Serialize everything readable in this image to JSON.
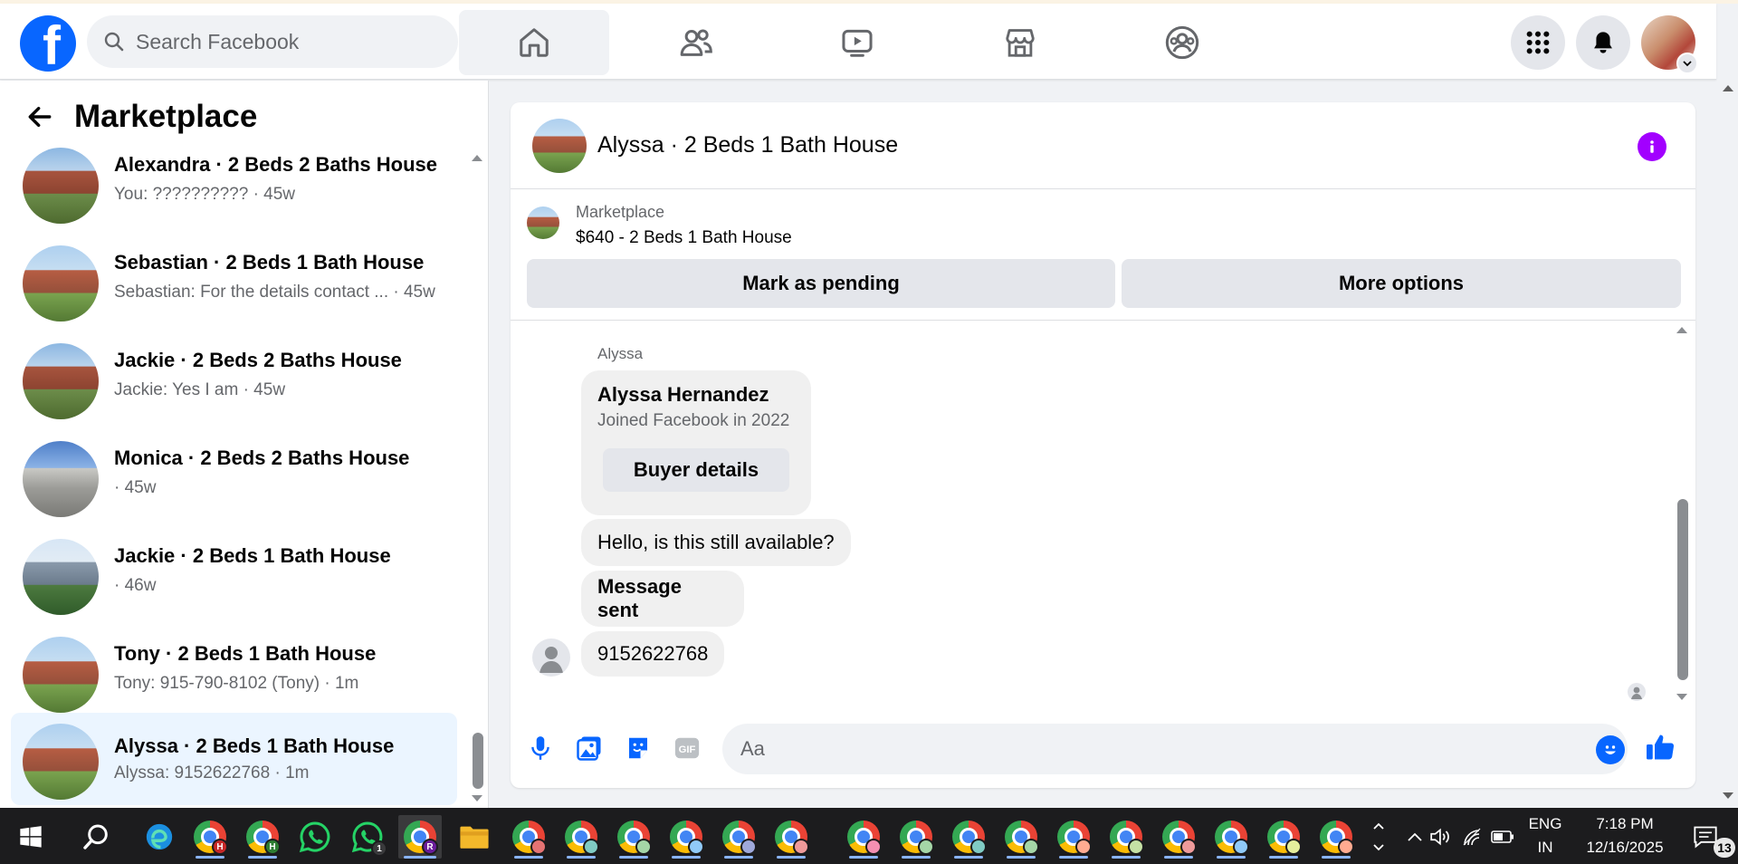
{
  "topbar": {
    "logo_text": "f",
    "search_placeholder": "Search Facebook",
    "colors": {
      "brand": "#0866ff"
    }
  },
  "sidebar": {
    "title": "Marketplace",
    "conversations": [
      {
        "title": "Alexandra · 2 Beds 2 Baths House",
        "subtitle": "You: ?????????? · 45w"
      },
      {
        "title": "Sebastian · 2 Beds 1 Bath House",
        "subtitle": "Sebastian: For the details contact ... · 45w"
      },
      {
        "title": "Jackie · 2 Beds 2 Baths House",
        "subtitle": "Jackie: Yes I am · 45w"
      },
      {
        "title": "Monica · 2 Beds 2 Baths House",
        "subtitle": "· 45w"
      },
      {
        "title": "Jackie · 2 Beds 1 Bath House",
        "subtitle": "· 46w"
      },
      {
        "title": "Tony · 2 Beds 1 Bath House",
        "subtitle": "Tony: 915-790-8102 (Tony) · 1m"
      },
      {
        "title": "Alyssa · 2 Beds 1 Bath House",
        "subtitle": "Alyssa: 9152622768 · 1m"
      }
    ]
  },
  "chat": {
    "title": "Alyssa · 2 Beds 1 Bath House",
    "listing": {
      "source": "Marketplace",
      "price_title": "$640 - 2 Beds 1 Bath House",
      "mark_pending": "Mark as pending",
      "more_options": "More options"
    },
    "sender_label": "Alyssa",
    "profile_card": {
      "name": "Alyssa Hernandez",
      "joined": "Joined Facebook in 2022",
      "button": "Buyer details"
    },
    "messages": [
      "Hello, is this still available?",
      "Message sent",
      "9152622768"
    ],
    "composer_placeholder": "Aa",
    "colors": {
      "info": "#a200ff",
      "accent": "#0866ff"
    }
  },
  "taskbar": {
    "lang_top": "ENG",
    "lang_bottom": "IN",
    "time": "7:18 PM",
    "date": "12/16/2025",
    "notification_count": "13",
    "whatsapp_badge": "1",
    "chrome_profiles": [
      "H",
      "H",
      "R"
    ]
  }
}
